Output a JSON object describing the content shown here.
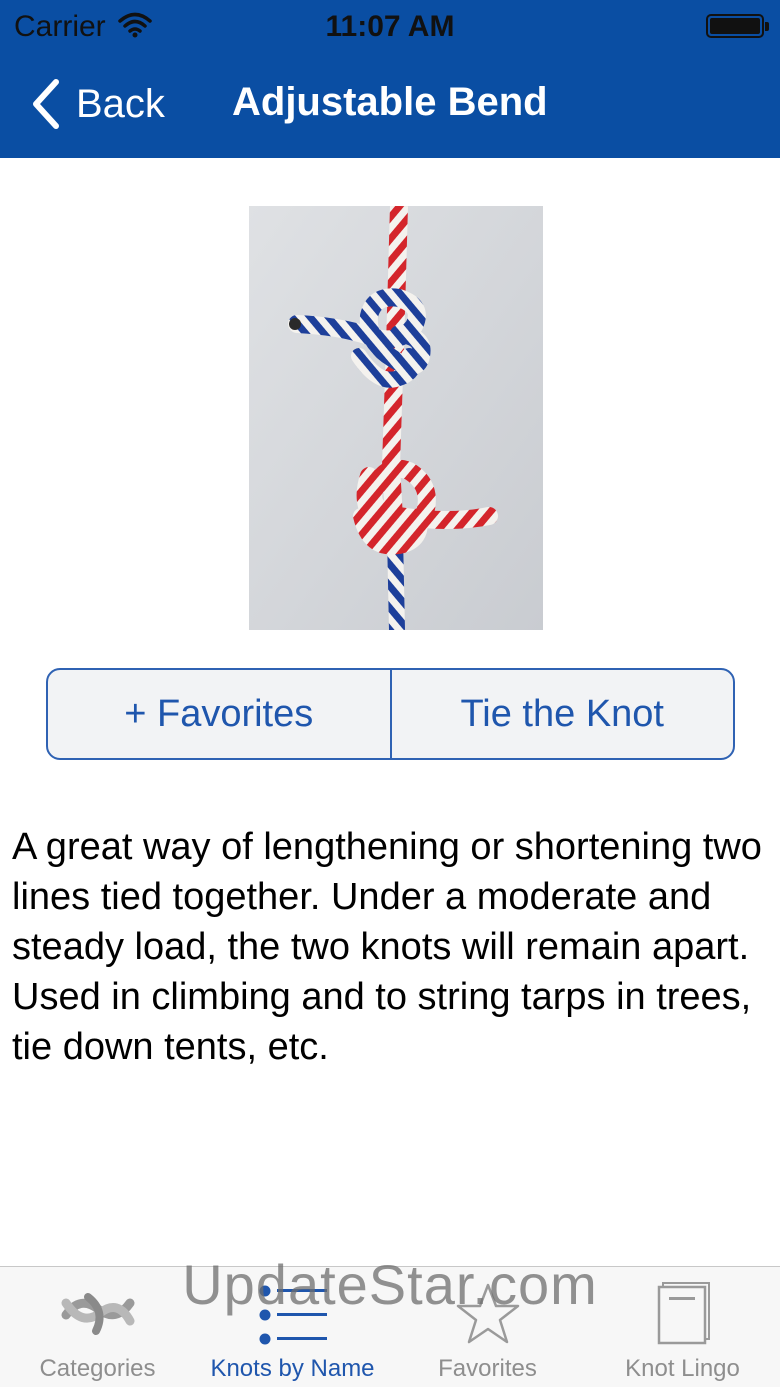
{
  "status": {
    "carrier": "Carrier",
    "time": "11:07 AM"
  },
  "nav": {
    "back_label": "Back",
    "title": "Adjustable Bend"
  },
  "actions": {
    "favorites_label": "+ Favorites",
    "tie_label": "Tie the Knot"
  },
  "description": "A great way of lengthening or shortening two lines tied together. Under a moderate and steady load, the two knots will remain apart. Used in climbing and to string tarps in trees, tie down tents, etc.",
  "tabs": [
    {
      "label": "Categories",
      "icon": "knot-icon",
      "active": false
    },
    {
      "label": "Knots by Name",
      "icon": "list-icon",
      "active": true
    },
    {
      "label": "Favorites",
      "icon": "star-icon",
      "active": false
    },
    {
      "label": "Knot Lingo",
      "icon": "book-icon",
      "active": false
    }
  ],
  "watermark": "UpdateStar.com",
  "colors": {
    "header": "#0a4ea3",
    "accent": "#1f56ad",
    "inactive": "#8e8e8e"
  }
}
